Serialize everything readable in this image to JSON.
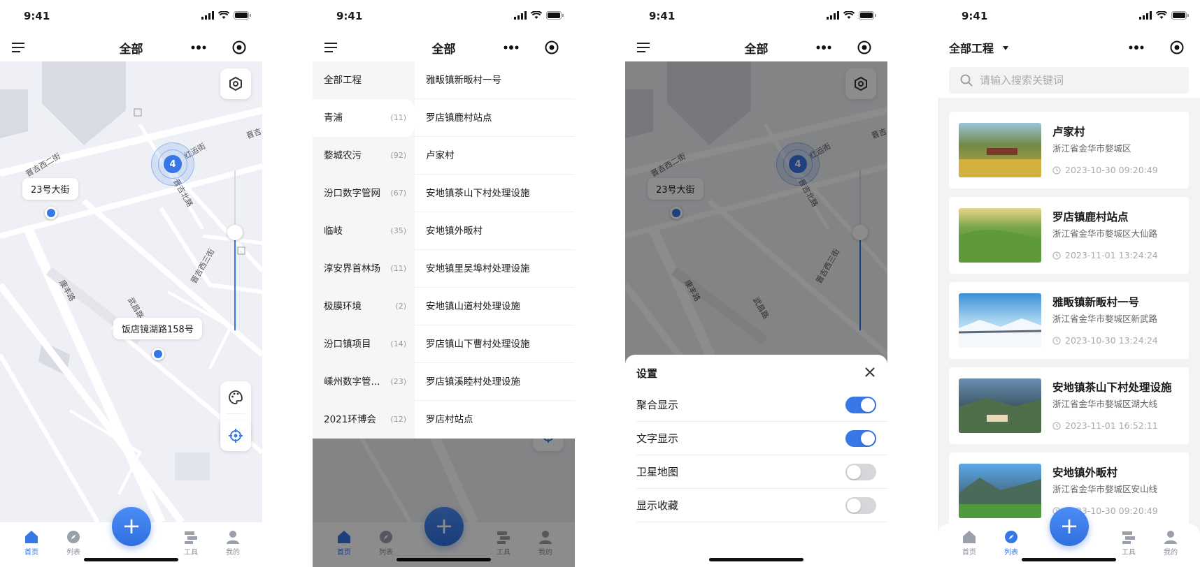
{
  "status": {
    "time": "9:41"
  },
  "screen1": {
    "title": "全部",
    "markers": [
      {
        "label": "23号大街"
      },
      {
        "label": "饭店镜湖路158号"
      }
    ],
    "cluster_count": "4",
    "roads": [
      "晋吉西二街",
      "红运街",
      "晋吉北路",
      "晋吉西三街",
      "康丰路",
      "武昌路",
      "晋吉"
    ],
    "tabs": [
      {
        "label": "首页"
      },
      {
        "label": "列表"
      },
      {
        "label": "工具"
      },
      {
        "label": "我的"
      }
    ],
    "fab": "+"
  },
  "screen2": {
    "title": "全部",
    "categories": [
      {
        "name": "全部工程",
        "count": ""
      },
      {
        "name": "青浦",
        "count": "(11)"
      },
      {
        "name": "婺城农污",
        "count": "(92)"
      },
      {
        "name": "汾口数字管网",
        "count": "(67)"
      },
      {
        "name": "临岐",
        "count": "(35)"
      },
      {
        "name": "淳安界首林场",
        "count": "(11)"
      },
      {
        "name": "极膜环境",
        "count": "(2)"
      },
      {
        "name": "汾口镇项目",
        "count": "(14)"
      },
      {
        "name": "嵊州数字管...",
        "count": "(23)"
      },
      {
        "name": "2021环博会",
        "count": "(12)"
      }
    ],
    "items": [
      "雅畈镇新畈村一号",
      "罗店镇鹿村站点",
      "卢家村",
      "安地镇茶山下村处理设施",
      "安地镇外畈村",
      "安地镇里吴埠村处理设施",
      "安地镇山道村处理设施",
      "罗店镇山下曹村处理设施",
      "罗店镇溪睦村处理设施",
      "罗店村站点"
    ]
  },
  "screen3": {
    "title": "全部",
    "marker": "23号大街",
    "cluster_count": "4",
    "roads": [
      "晋吉西二街",
      "红运街",
      "晋吉北路",
      "晋吉西三街",
      "康丰路",
      "武昌路",
      "晋吉"
    ],
    "sheet_title": "设置",
    "settings": [
      {
        "label": "聚合显示",
        "on": true
      },
      {
        "label": "文字显示",
        "on": true
      },
      {
        "label": "卫星地图",
        "on": false
      },
      {
        "label": "显示收藏",
        "on": false
      }
    ]
  },
  "screen4": {
    "dropdown_title": "全部工程",
    "search_placeholder": "请输入搜索关键词",
    "cards": [
      {
        "name": "卢家村",
        "addr": "浙江省金华市婺城区",
        "time": "2023-10-30 09:20:49"
      },
      {
        "name": "罗店镇鹿村站点",
        "addr": "浙江省金华市婺城区大仙路",
        "time": "2023-11-01 13:24:24"
      },
      {
        "name": "雅畈镇新畈村一号",
        "addr": "浙江省金华市婺城区新武路",
        "time": "2023-10-30 13:24:24"
      },
      {
        "name": "安地镇茶山下村处理设施",
        "addr": "浙江省金华市婺城区湖大线",
        "time": "2023-11-01 16:52:11"
      },
      {
        "name": "安地镇外畈村",
        "addr": "浙江省金华市婺城区安山线",
        "time": "2023-10-30 09:20:49"
      }
    ]
  },
  "colors": {
    "accent": "#3777e6",
    "map_bg": "#eef0f5",
    "road": "#ffffff",
    "building": "#d8dbe2"
  }
}
